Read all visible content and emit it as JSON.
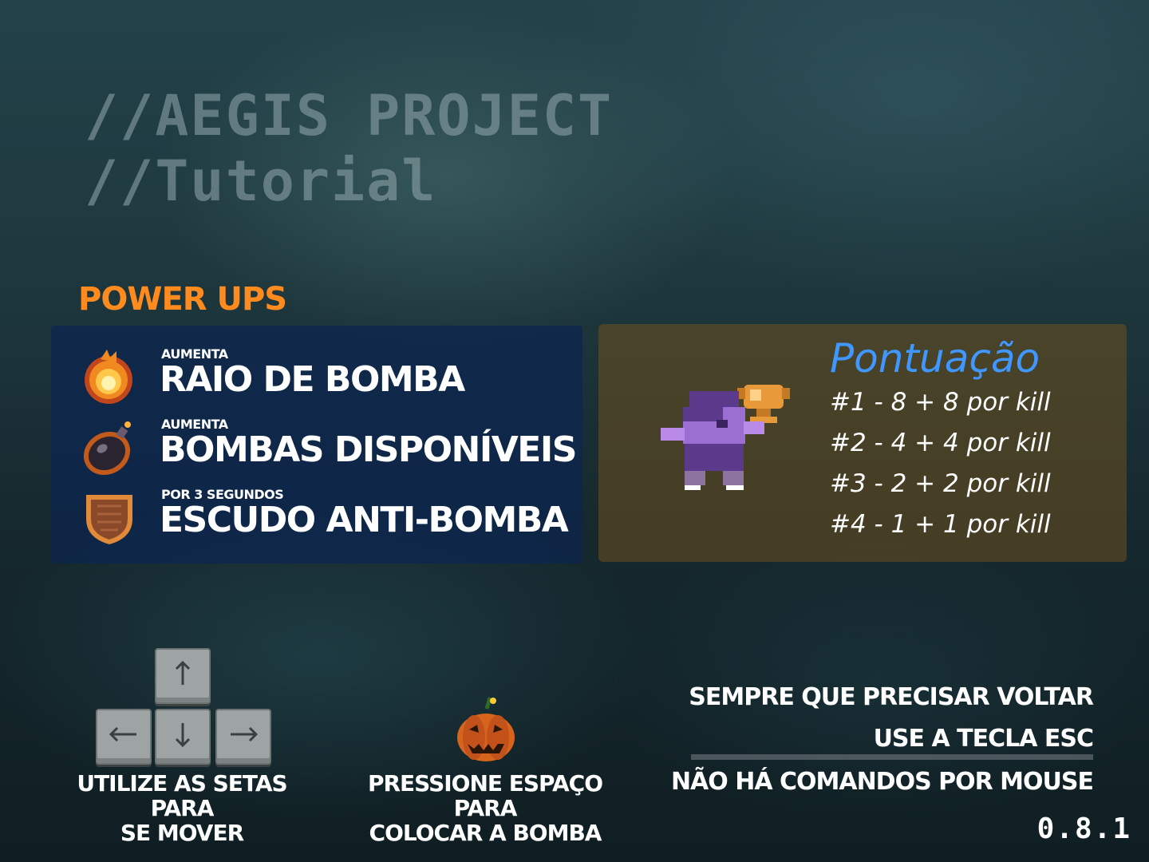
{
  "header": {
    "line1": "//AEGIS PROJECT",
    "line2": "//Tutorial"
  },
  "powerups": {
    "heading": "POWER UPS",
    "items": [
      {
        "icon": "fire-icon",
        "small": "AUMENTA",
        "big": "RAIO DE BOMBA"
      },
      {
        "icon": "bomb-icon",
        "small": "AUMENTA",
        "big": "BOMBAS DISPONÍVEIS"
      },
      {
        "icon": "shield-icon",
        "small": "POR 3 SEGUNDOS",
        "big": "ESCUDO ANTI-BOMBA"
      }
    ]
  },
  "score": {
    "title": "Pontuação",
    "lines": [
      "#1  -  8 + 8 por kill",
      "#2  -  4 + 4 por kill",
      "#3  -  2 + 2 por kill",
      "#4  -  1 + 1 por kill"
    ]
  },
  "controls": {
    "arrows_label_1": "UTILIZE AS SETAS PARA",
    "arrows_label_2": "SE MOVER",
    "space_label_1": "PRESSIONE ESPAÇO PARA",
    "space_label_2": "COLOCAR A BOMBA"
  },
  "esc": {
    "line1": "SEMPRE QUE PRECISAR VOLTAR",
    "line2": "USE A TECLA ESC",
    "line3": "NÃO HÁ COMANDOS POR MOUSE"
  },
  "version": "0.8.1",
  "colors": {
    "accent_orange": "#ff8a1e",
    "score_blue": "#3f97ff"
  }
}
